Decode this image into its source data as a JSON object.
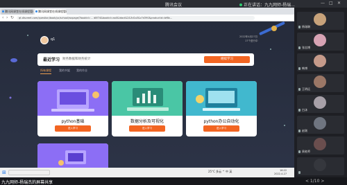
{
  "meeting": {
    "title": "腾讯会议",
    "speaker": "正在讲话：九九网师-杨瑞...",
    "window_controls": [
      "—",
      "□",
      "✕"
    ]
  },
  "browser": {
    "tabs": [
      "腾讯网课堂在线课程管理平台",
      "腾讯网课堂在线课程管理平台"
    ],
    "url": "qt.dlscreet.com/question/book/pc/school/wxpage/?bookid=... d8f74&bookid=aa0&idact&2&3d1a3&c?d390&productid=bf6b..."
  },
  "header": {
    "username": "q1",
    "date": "2022年4月27日",
    "status": "17个进行中"
  },
  "banner": {
    "title": "最近学习",
    "subtitle": "财务数据和财务统计",
    "button": "继续学习"
  },
  "filters": [
    "所有课程",
    "我的书架",
    "我的作业"
  ],
  "cards": [
    {
      "name": "python基础",
      "button": "进入学习"
    },
    {
      "name": "数据分析及可视化",
      "button": "进入学习"
    },
    {
      "name": "python办公自动化",
      "button": "进入学习"
    },
    {
      "name": "",
      "button": ""
    }
  ],
  "taskbar": {
    "tray_text": "25°C 多云  ^  中  英",
    "time": "16:22",
    "date": "2022-4-27"
  },
  "participants": [
    {
      "name": "杨瑞琳",
      "color": "#c7a27a"
    },
    {
      "name": "张志博",
      "color": "#d7a3b4"
    },
    {
      "name": "韩博",
      "color": "#c59a8a"
    },
    {
      "name": "王明远",
      "color": "#9b7766"
    },
    {
      "name": "白沫",
      "color": "#a7a0a8"
    },
    {
      "name": "赵刚",
      "color": "#6f7580"
    },
    {
      "name": "周老师",
      "color": "#6a4e4e"
    },
    {
      "name": "",
      "color": "#35373d"
    }
  ],
  "bottom": {
    "share_label": "九九网师-杨瑞杰的屏幕共享",
    "page_indicator": "< 1/10 >"
  },
  "colors": {
    "accent": "#f26522",
    "page_bg": "#252b3b",
    "card_purple": "#8c6ef5",
    "card_green": "#4ac6a5",
    "card_teal": "#41b8ce"
  }
}
